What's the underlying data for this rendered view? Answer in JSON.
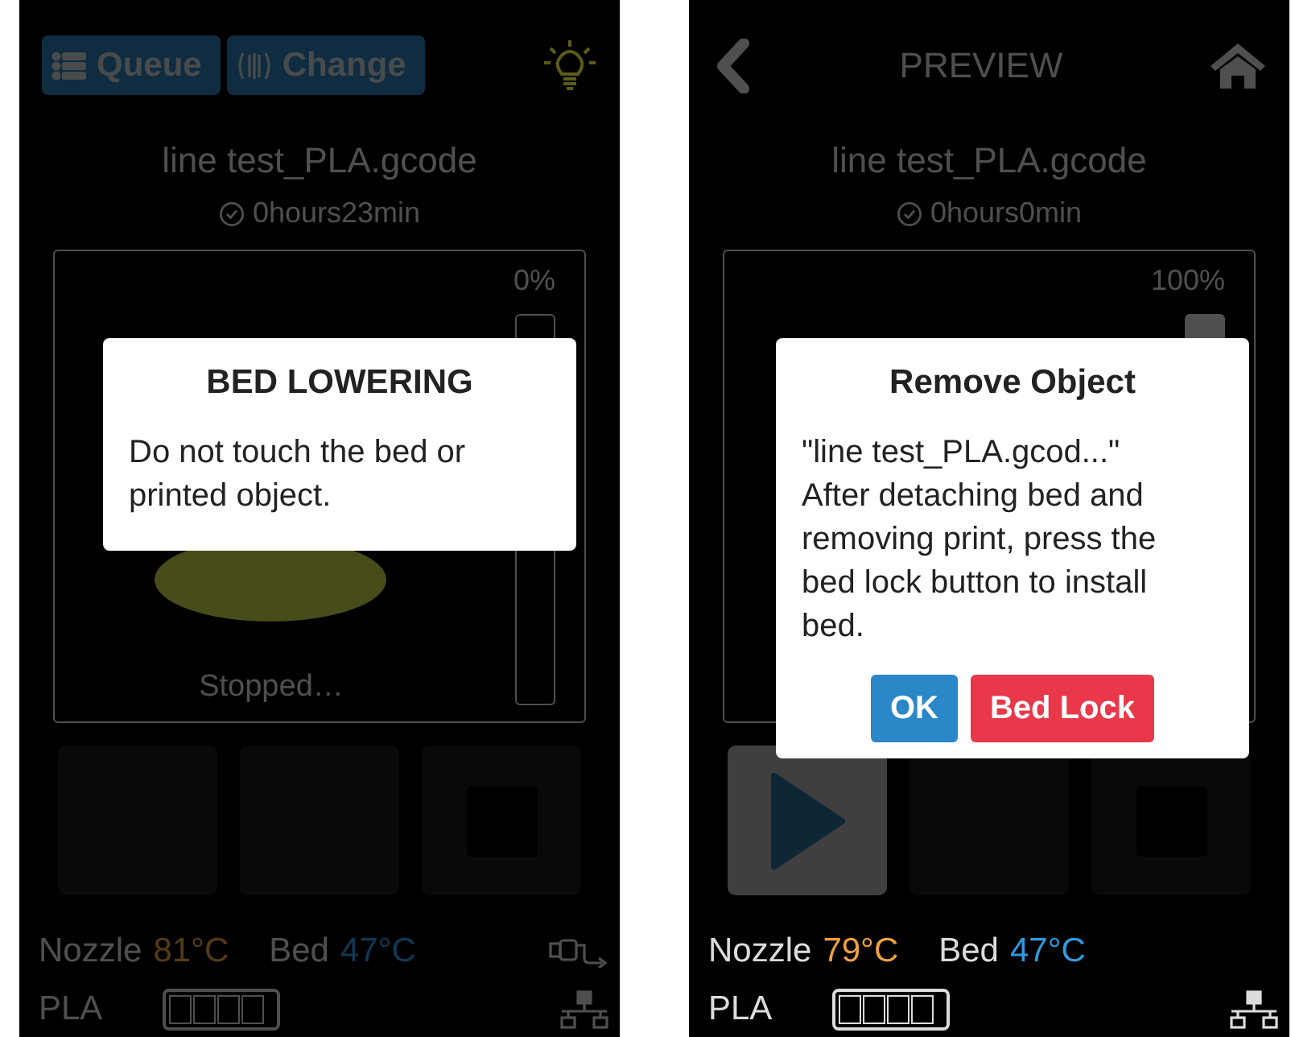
{
  "screens": [
    {
      "header": {
        "kind": "toolbar",
        "buttons": [
          {
            "label": "Queue"
          },
          {
            "label": "Change"
          }
        ]
      },
      "file_name": "line test_PLA.gcode",
      "print_time": "0hours23min",
      "progress": {
        "reading": "0%",
        "level": 0
      },
      "status": "Stopped…",
      "tiles": [
        {
          "kind": "blank"
        },
        {
          "kind": "blank"
        },
        {
          "kind": "stop"
        }
      ],
      "temps": {
        "nozzle_label": "Nozzle",
        "nozzle": "81°C",
        "bed_label": "Bed",
        "bed": "47°C"
      },
      "filament": "PLA",
      "cable_connected": true,
      "footer_dimmed": true,
      "dialog": {
        "title": "BED LOWERING",
        "body": "Do not touch the bed or printed object."
      }
    },
    {
      "header": {
        "kind": "nav",
        "title": "PREVIEW"
      },
      "file_name": "line test_PLA.gcode",
      "print_time": "0hours0min",
      "progress": {
        "reading": "100%",
        "level": 1
      },
      "tiles": [
        {
          "kind": "play"
        },
        {
          "kind": "blank"
        },
        {
          "kind": "stop"
        }
      ],
      "temps": {
        "nozzle_label": "Nozzle",
        "nozzle": "79°C",
        "bed_label": "Bed",
        "bed": "47°C"
      },
      "filament": "PLA",
      "cable_connected": false,
      "footer_dimmed": false,
      "dialog": {
        "title": "Remove Object",
        "body": "\"line test_PLA.gcod...\"\nAfter detaching bed and removing print, press the bed lock button to install bed.",
        "buttons": [
          {
            "label": "OK",
            "kind": "primary"
          },
          {
            "label": "Bed Lock",
            "kind": "danger"
          }
        ]
      }
    }
  ]
}
